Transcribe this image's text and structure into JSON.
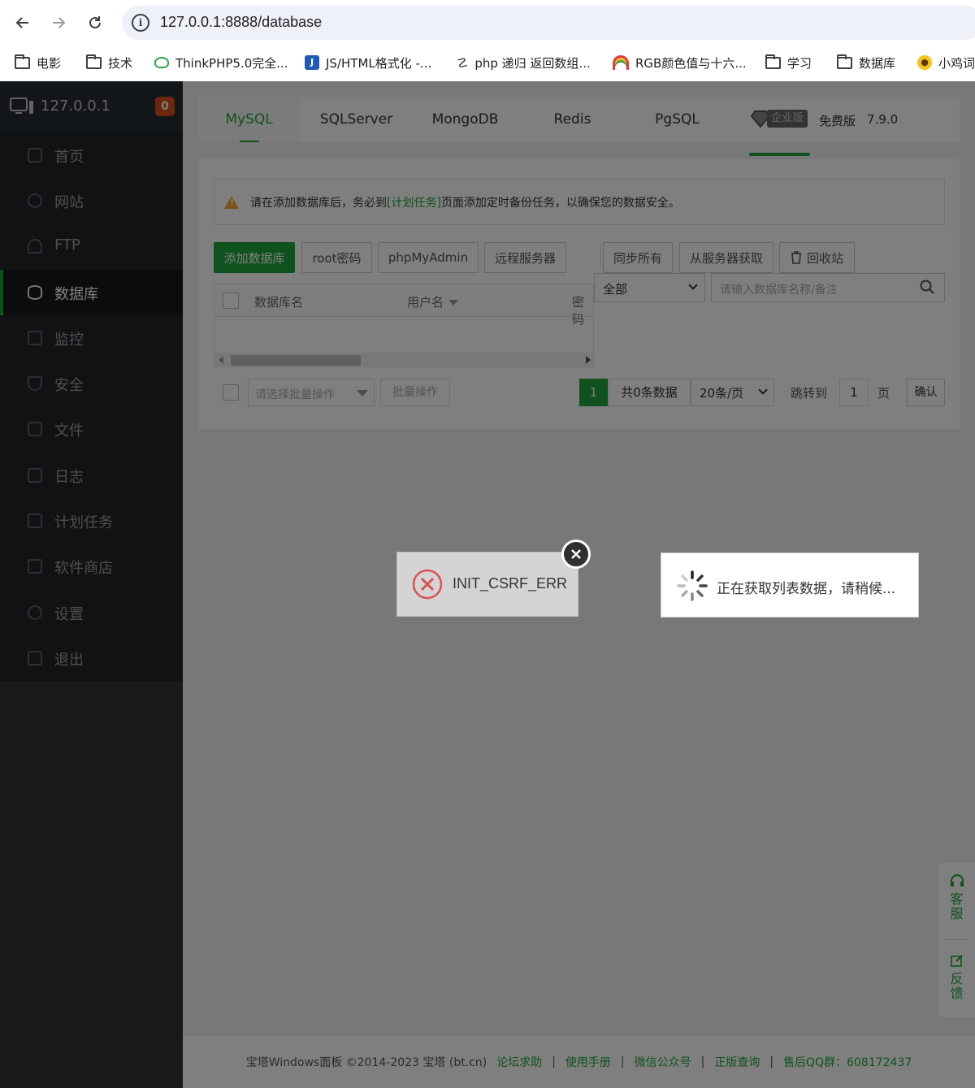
{
  "browser": {
    "url": "127.0.0.1:8888/database",
    "bookmarks": [
      {
        "label": "电影",
        "icon": "folder-icon"
      },
      {
        "label": "技术",
        "icon": "folder-icon"
      },
      {
        "label": "ThinkPHP5.0完全...",
        "icon": "thinkphp-icon"
      },
      {
        "label": "JS/HTML格式化 -...",
        "icon": "jsformat-icon"
      },
      {
        "label": "php 递归 返回数组...",
        "icon": "php-icon"
      },
      {
        "label": "RGB颜色值与十六...",
        "icon": "rainbow-icon"
      },
      {
        "label": "学习",
        "icon": "folder-icon"
      },
      {
        "label": "数据库",
        "icon": "folder-icon"
      },
      {
        "label": "小鸡词",
        "icon": "chick-icon"
      }
    ]
  },
  "sidebar": {
    "ip": "127.0.0.1",
    "badge": "0",
    "items": [
      {
        "label": "首页",
        "icon": "home-icon"
      },
      {
        "label": "网站",
        "icon": "globe-icon"
      },
      {
        "label": "FTP",
        "icon": "ftp-icon"
      },
      {
        "label": "数据库",
        "icon": "database-icon",
        "active": true
      },
      {
        "label": "监控",
        "icon": "monitor-icon"
      },
      {
        "label": "安全",
        "icon": "shield-icon"
      },
      {
        "label": "文件",
        "icon": "folder-icon"
      },
      {
        "label": "日志",
        "icon": "log-icon"
      },
      {
        "label": "计划任务",
        "icon": "calendar-icon"
      },
      {
        "label": "软件商店",
        "icon": "apps-icon"
      },
      {
        "label": "设置",
        "icon": "gear-icon"
      },
      {
        "label": "退出",
        "icon": "logout-icon"
      }
    ]
  },
  "tabs": {
    "items": [
      "MySQL",
      "SQLServer",
      "MongoDB",
      "Redis",
      "PgSQL"
    ],
    "enterprise": "企业版",
    "free": "免费版",
    "version": "7.9.0"
  },
  "notice": {
    "before": "请在添加数据库后，务必到",
    "link": "[计划任务]",
    "after": "页面添加定时备份任务，以确保您的数据安全。"
  },
  "toolbar": {
    "add_db": "添加数据库",
    "root_pwd": "root密码",
    "phpmyadmin": "phpMyAdmin",
    "remote": "远程服务器",
    "sync_all": "同步所有",
    "fetch": "从服务器获取",
    "recycle": "回收站"
  },
  "filter": {
    "type": "全部",
    "search_placeholder": "请输入数据库名称/备注"
  },
  "table": {
    "columns": [
      "数据库名",
      "用户名",
      "密码"
    ]
  },
  "pager": {
    "batch_placeholder": "请选择批量操作",
    "batch_btn": "批量操作",
    "current": "1",
    "total": "共0条数据",
    "page_size": "20条/页",
    "jump_label": "跳转到",
    "jump_value": "1",
    "page_label": "页",
    "confirm": "确认"
  },
  "footer": {
    "copyright": "宝塔Windows面板 ©2014-2023 宝塔 (bt.cn)",
    "links": [
      "论坛求助",
      "使用手册",
      "微信公众号",
      "正版查询",
      "售后QQ群：608172437"
    ]
  },
  "float": {
    "service": "客服",
    "feedback": "反馈"
  },
  "dialogs": {
    "error": "INIT_CSRF_ERR",
    "loading": "正在获取列表数据，请稍候..."
  },
  "colors": {
    "accent": "#20a53a",
    "sidebar_bg": "#202428",
    "badge": "#d5501d",
    "error": "#d9534f"
  }
}
